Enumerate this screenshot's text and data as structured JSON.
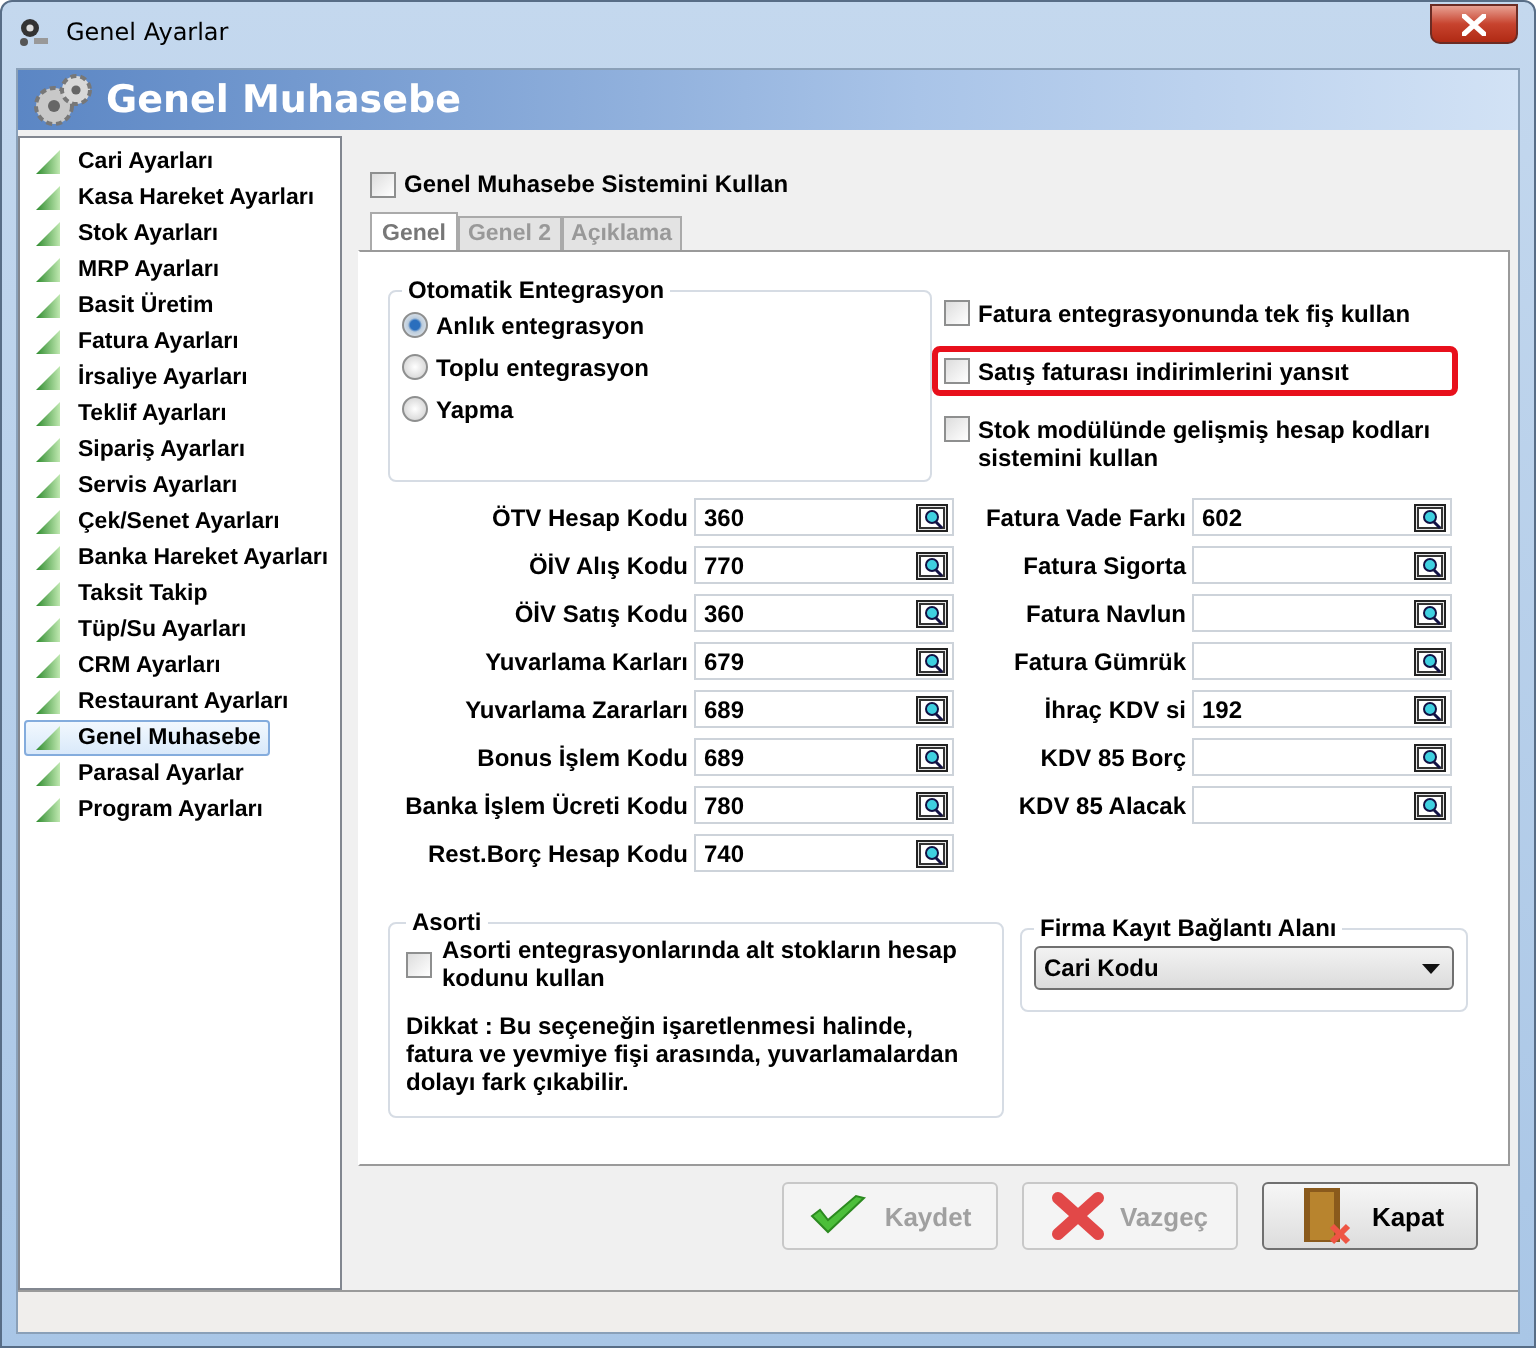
{
  "window": {
    "title": "Genel Ayarlar"
  },
  "header": {
    "title": "Genel Muhasebe"
  },
  "sidebar": {
    "items": [
      {
        "label": "Cari Ayarları",
        "selected": false
      },
      {
        "label": "Kasa Hareket Ayarları",
        "selected": false
      },
      {
        "label": "Stok Ayarları",
        "selected": false
      },
      {
        "label": "MRP Ayarları",
        "selected": false
      },
      {
        "label": "Basit Üretim",
        "selected": false
      },
      {
        "label": "Fatura Ayarları",
        "selected": false
      },
      {
        "label": "İrsaliye Ayarları",
        "selected": false
      },
      {
        "label": "Teklif Ayarları",
        "selected": false
      },
      {
        "label": "Sipariş Ayarları",
        "selected": false
      },
      {
        "label": "Servis Ayarları",
        "selected": false
      },
      {
        "label": "Çek/Senet Ayarları",
        "selected": false
      },
      {
        "label": "Banka Hareket Ayarları",
        "selected": false
      },
      {
        "label": "Taksit Takip",
        "selected": false
      },
      {
        "label": "Tüp/Su Ayarları",
        "selected": false
      },
      {
        "label": "CRM Ayarları",
        "selected": false
      },
      {
        "label": "Restaurant Ayarları",
        "selected": false
      },
      {
        "label": "Genel Muhasebe",
        "selected": true
      },
      {
        "label": "Parasal Ayarlar",
        "selected": false
      },
      {
        "label": "Program Ayarları",
        "selected": false
      }
    ]
  },
  "main_checkbox": {
    "label": "Genel Muhasebe Sistemini Kullan",
    "checked": false
  },
  "tabs": [
    {
      "label": "Genel",
      "selected": true
    },
    {
      "label": "Genel 2",
      "selected": false
    },
    {
      "label": "Açıklama",
      "selected": false
    }
  ],
  "integration_group": {
    "title": "Otomatik Entegrasyon",
    "options": [
      {
        "label": "Anlık entegrasyon",
        "selected": true
      },
      {
        "label": "Toplu entegrasyon",
        "selected": false
      },
      {
        "label": "Yapma",
        "selected": false
      }
    ]
  },
  "options": [
    {
      "label": "Fatura entegrasyonunda tek fiş kullan",
      "checked": false,
      "highlighted": false
    },
    {
      "label": "Satış faturası indirimlerini yansıt",
      "checked": false,
      "highlighted": true
    },
    {
      "label": "Stok modülünde gelişmiş hesap kodları sistemini kullan",
      "checked": false,
      "highlighted": false
    }
  ],
  "left_fields": [
    {
      "label": "ÖTV Hesap Kodu",
      "value": "360"
    },
    {
      "label": "ÖİV Alış Kodu",
      "value": "770"
    },
    {
      "label": "ÖİV Satış Kodu",
      "value": "360"
    },
    {
      "label": "Yuvarlama Karları",
      "value": "679"
    },
    {
      "label": "Yuvarlama Zararları",
      "value": "689"
    },
    {
      "label": "Bonus İşlem Kodu",
      "value": "689"
    },
    {
      "label": "Banka İşlem Ücreti Kodu",
      "value": "780"
    },
    {
      "label": "Rest.Borç Hesap Kodu",
      "value": "740"
    }
  ],
  "right_fields": [
    {
      "label": "Fatura Vade Farkı",
      "value": "602"
    },
    {
      "label": "Fatura Sigorta"
    },
    {
      "label": "Fatura Navlun"
    },
    {
      "label": "Fatura Gümrük"
    },
    {
      "label": "İhraç KDV si",
      "value": "192"
    },
    {
      "label": "KDV 85 Borç"
    },
    {
      "label": "KDV 85 Alacak"
    }
  ],
  "asorti_group": {
    "title": "Asorti",
    "checkbox": {
      "label": "Asorti entegrasyonlarında alt stokların hesap kodunu kullan",
      "checked": false
    },
    "note": "Dikkat : Bu seçeneğin işaretlenmesi halinde, fatura ve yevmiye fişi arasında, yuvarlamalardan dolayı fark çıkabilir."
  },
  "link_group": {
    "title": "Firma Kayıt Bağlantı Alanı",
    "dropdown": {
      "value": "Cari Kodu"
    }
  },
  "buttons": [
    {
      "label": "Kaydet",
      "kind": "save",
      "disabled": true
    },
    {
      "label": "Vazgeç",
      "kind": "cancel",
      "disabled": true
    },
    {
      "label": "Kapat",
      "kind": "close",
      "disabled": false
    }
  ]
}
